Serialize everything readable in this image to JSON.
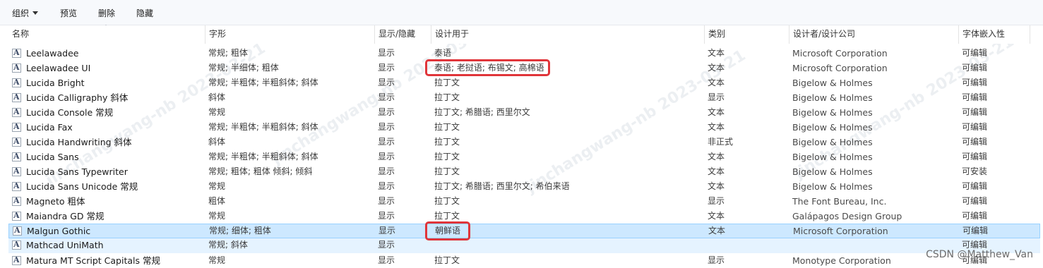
{
  "toolbar": {
    "organize": "组织",
    "preview": "预览",
    "delete": "删除",
    "hide": "隐藏"
  },
  "columns": [
    "名称",
    "字形",
    "显示/隐藏",
    "设计用于",
    "类别",
    "设计者/设计公司",
    "字体嵌入性"
  ],
  "rows": [
    {
      "name": "Leelawadee",
      "style": "常规; 粗体",
      "show": "显示",
      "design": "泰语",
      "category": "文本",
      "designer": "Microsoft Corporation",
      "embed": "可编辑"
    },
    {
      "name": "Leelawadee UI",
      "style": "常规; 半细体; 粗体",
      "show": "显示",
      "design": "泰语; 老挝语; 布锡文; 高棉语",
      "category": "文本",
      "designer": "Microsoft Corporation",
      "embed": "可编辑"
    },
    {
      "name": "Lucida Bright",
      "style": "常规; 半粗体; 半粗斜体; 斜体",
      "show": "显示",
      "design": "拉丁文",
      "category": "文本",
      "designer": "Bigelow & Holmes",
      "embed": "可编辑"
    },
    {
      "name": "Lucida Calligraphy 斜体",
      "style": "斜体",
      "show": "显示",
      "design": "拉丁文",
      "category": "显示",
      "designer": "Bigelow & Holmes",
      "embed": "可编辑"
    },
    {
      "name": "Lucida Console 常规",
      "style": "常规",
      "show": "显示",
      "design": "拉丁文; 希腊语; 西里尔文",
      "category": "文本",
      "designer": "Bigelow & Holmes",
      "embed": "可编辑"
    },
    {
      "name": "Lucida Fax",
      "style": "常规; 半粗体; 半粗斜体; 斜体",
      "show": "显示",
      "design": "拉丁文",
      "category": "文本",
      "designer": "Bigelow & Holmes",
      "embed": "可编辑"
    },
    {
      "name": "Lucida Handwriting 斜体",
      "style": "斜体",
      "show": "显示",
      "design": "拉丁文",
      "category": "非正式",
      "designer": "Bigelow & Holmes",
      "embed": "可编辑"
    },
    {
      "name": "Lucida Sans",
      "style": "常规; 半粗体; 半粗斜体; 斜体",
      "show": "显示",
      "design": "拉丁文",
      "category": "文本",
      "designer": "Bigelow & Holmes",
      "embed": "可编辑"
    },
    {
      "name": "Lucida Sans Typewriter",
      "style": "常规; 粗体; 粗体 倾斜; 倾斜",
      "show": "显示",
      "design": "拉丁文",
      "category": "文本",
      "designer": "Bigelow & Holmes",
      "embed": "可安装"
    },
    {
      "name": "Lucida Sans Unicode 常规",
      "style": "常规",
      "show": "显示",
      "design": "拉丁文; 希腊语; 西里尔文; 希伯来语",
      "category": "文本",
      "designer": "Bigelow & Holmes",
      "embed": "可编辑"
    },
    {
      "name": "Magneto 粗体",
      "style": "粗体",
      "show": "显示",
      "design": "拉丁文",
      "category": "显示",
      "designer": "The Font Bureau, Inc.",
      "embed": "可编辑"
    },
    {
      "name": "Maiandra GD 常规",
      "style": "常规",
      "show": "显示",
      "design": "拉丁文",
      "category": "文本",
      "designer": "Galápagos Design Group",
      "embed": "可编辑"
    },
    {
      "name": "Malgun Gothic",
      "style": "常规; 细体; 粗体",
      "show": "显示",
      "design": "朝鲜语",
      "category": "文本",
      "designer": "Microsoft Corporation",
      "embed": "可编辑"
    },
    {
      "name": "Mathcad UniMath",
      "style": "常规; 斜体",
      "show": "显示",
      "design": "",
      "category": "",
      "designer": "",
      "embed": "可编辑"
    },
    {
      "name": "Matura MT Script Capitals 常规",
      "style": "常规",
      "show": "显示",
      "design": "拉丁文",
      "category": "显示",
      "designer": "Monotype Corporation",
      "embed": "可编辑"
    }
  ],
  "icon_glyph": "A",
  "watermark": "CSDN @Matthew_Van",
  "diagonal_watermark": "jinchangwang-nb 2023-03-21",
  "colors": {
    "selection_bg": "#cde8ff",
    "selection_border": "#99d1ff",
    "highlight_box": "#e0353a"
  }
}
